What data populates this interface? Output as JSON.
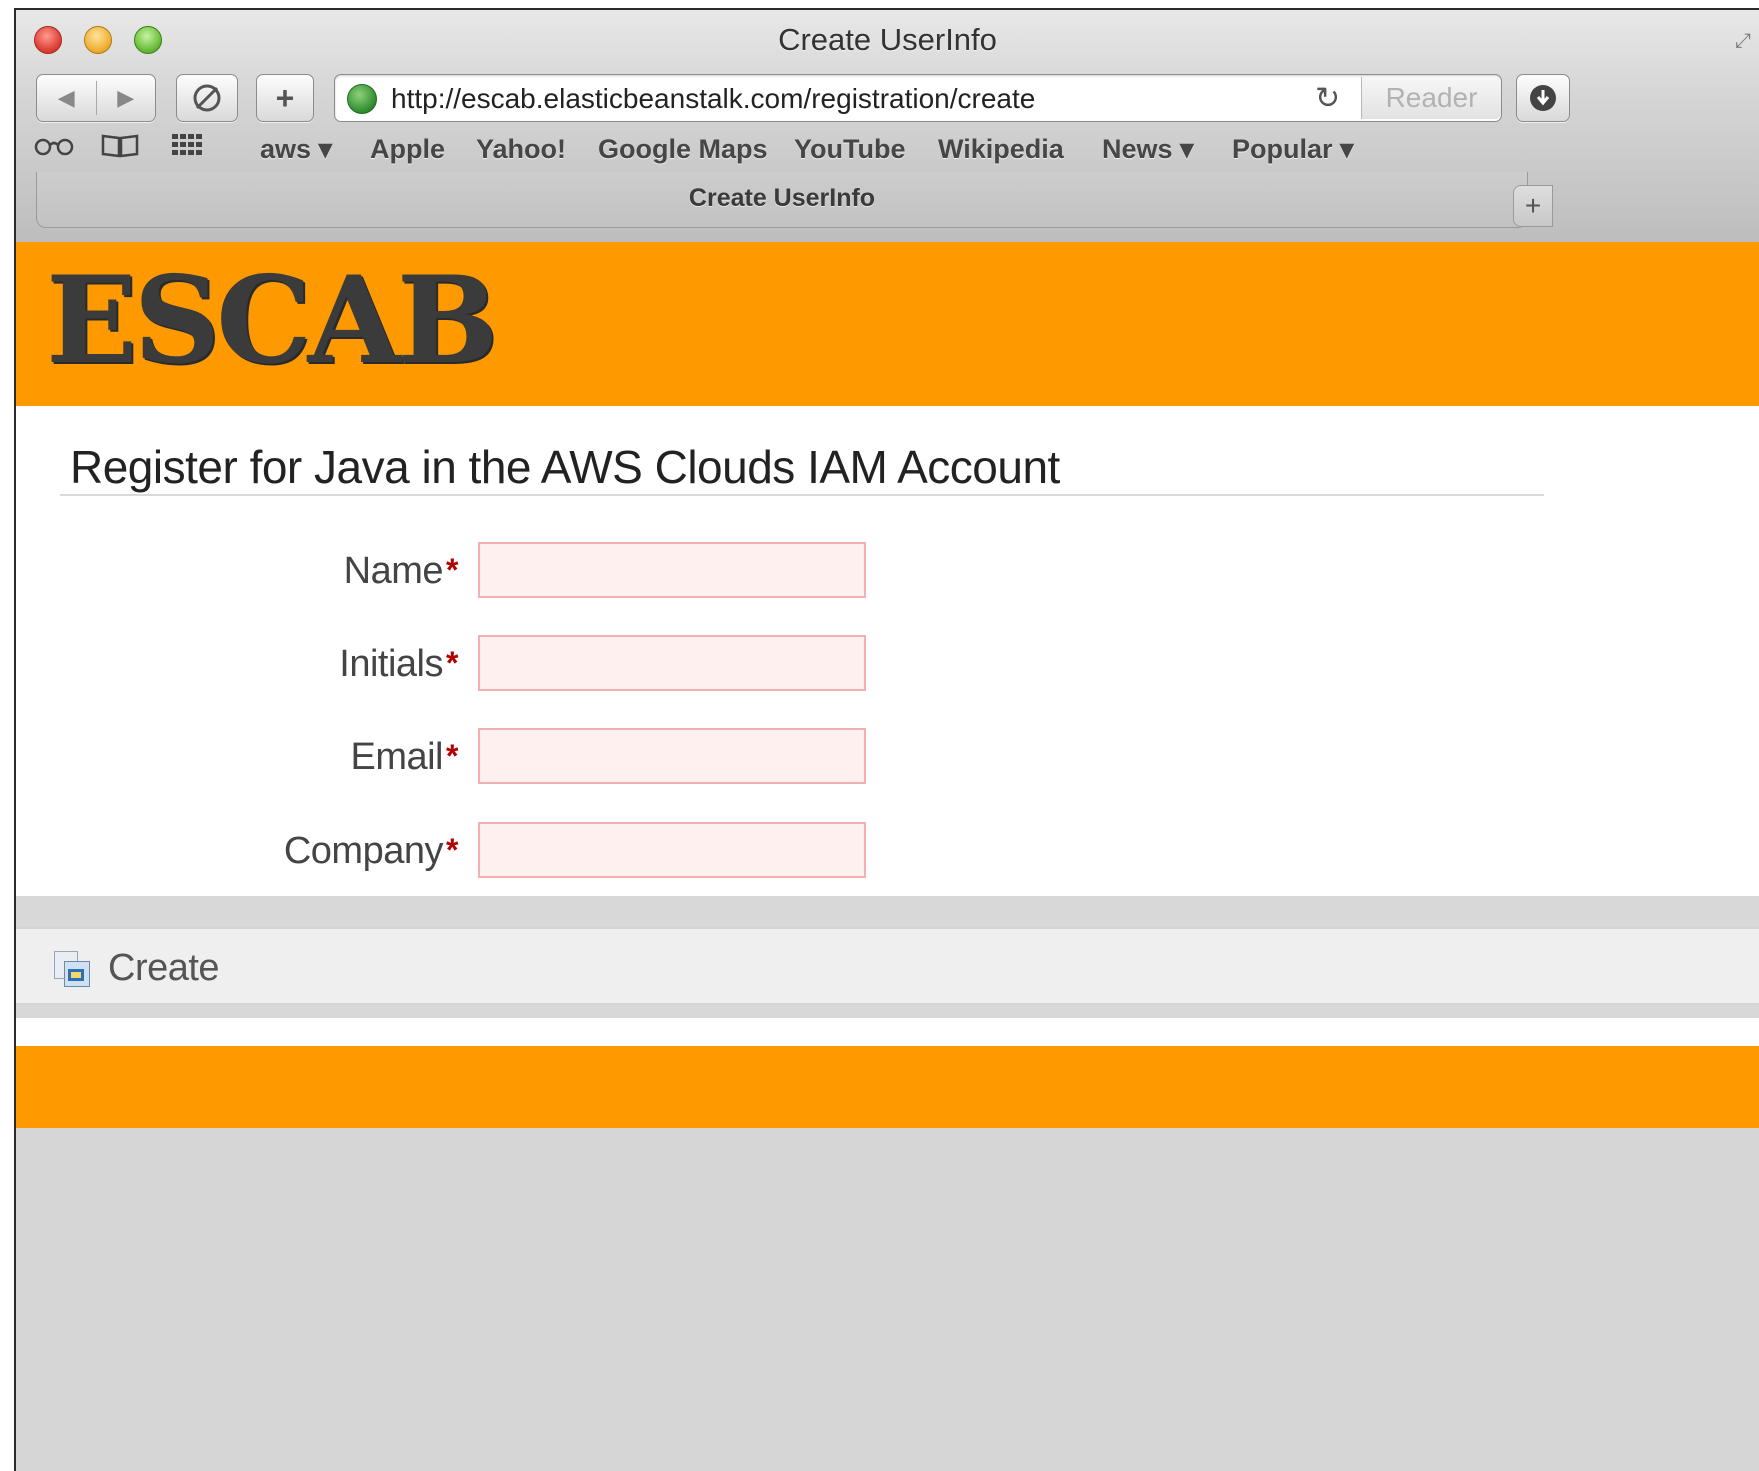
{
  "window": {
    "title": "Create UserInfo"
  },
  "toolbar": {
    "back_glyph": "◀",
    "forward_glyph": "▶",
    "plus_glyph": "+",
    "url": "http://escab.elasticbeanstalk.com/registration/create",
    "reader_label": "Reader",
    "reload_glyph": "↻",
    "download_glyph": "⬇"
  },
  "bookmarks": {
    "items": [
      {
        "label": "aws ▾"
      },
      {
        "label": "Apple"
      },
      {
        "label": "Yahoo!"
      },
      {
        "label": "Google Maps"
      },
      {
        "label": "YouTube"
      },
      {
        "label": "Wikipedia"
      },
      {
        "label": "News ▾"
      },
      {
        "label": "Popular ▾"
      }
    ]
  },
  "tabs": {
    "active_label": "Create UserInfo",
    "new_tab_glyph": "+"
  },
  "site": {
    "logo_text": "ESCAB",
    "brand_color": "#ff9900"
  },
  "main": {
    "title": "Register for Java in the AWS Clouds IAM Account",
    "required_marker": "*",
    "fields": [
      {
        "label": "Name",
        "value": "",
        "placeholder": ""
      },
      {
        "label": "Initials",
        "value": "",
        "placeholder": ""
      },
      {
        "label": "Email",
        "value": "",
        "placeholder": ""
      },
      {
        "label": "Company",
        "value": "",
        "placeholder": ""
      }
    ],
    "create_label": "Create"
  },
  "icons": {
    "site_icon": "beanstalk-site-icon",
    "create_icon": "save-icon",
    "reading-list": "glasses-icon",
    "bookmarks": "book-icon",
    "top-sites": "grid-icon"
  }
}
